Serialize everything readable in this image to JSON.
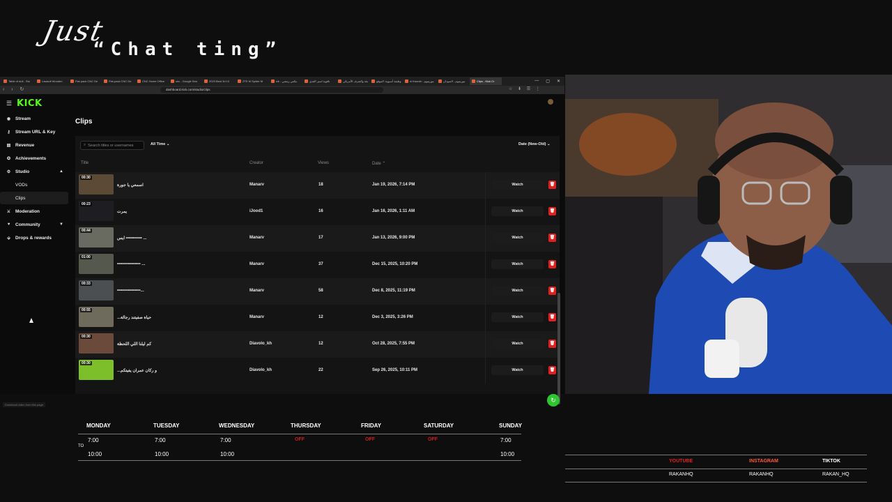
{
  "overlay": {
    "line1": "Just",
    "line2": "“Chat ting”"
  },
  "browser": {
    "tabs": [
      "Table of dull - Stu",
      "Lawsuit Wooden",
      "Flat pack CNC De",
      "Flat-pack CNC De",
      "CNC Home Office",
      "cnc - Google Sea",
      "2023 Best 3d 10",
      "ZTE M Spider M",
      "rdr - مكس ريتشي",
      "ناقوية اسيز القدي",
      "الأسابقة والشرف الأمريكي",
      "وظيفة أسيوية: الموقع",
      "ni fraurah - موريتيوم",
      "موريتيوم - السودان",
      "Clips - Kick Cr"
    ],
    "url": "dashboard.kick.com/studio/clips",
    "status_text": "Download video from this page"
  },
  "sidebar": {
    "logo": "KICK",
    "items": [
      {
        "label": "Stream",
        "icon": "stream-icon"
      },
      {
        "label": "Stream URL & Key",
        "icon": "key-icon"
      },
      {
        "label": "Revenue",
        "icon": "revenue-icon"
      },
      {
        "label": "Achievements",
        "icon": "achievements-icon"
      },
      {
        "label": "Studio",
        "icon": "studio-icon"
      },
      {
        "label": "VODs"
      },
      {
        "label": "Clips"
      },
      {
        "label": "Moderation",
        "icon": "moderation-icon"
      },
      {
        "label": "Community",
        "icon": "community-icon"
      },
      {
        "label": "Drops & rewards",
        "icon": "drops-icon"
      }
    ]
  },
  "main": {
    "heading": "Clips",
    "search_placeholder": "Search titles or usernames",
    "filter": "All Time",
    "sort": "Date (New-Old)",
    "columns": {
      "title": "Title",
      "creator": "Creator",
      "views": "Views",
      "date": "Date"
    },
    "watch_label": "Watch",
    "rows": [
      {
        "duration": "00:30",
        "title": "اسمعي يا جورة",
        "creator": "Manarv",
        "views": "18",
        "date": "Jan 19, 2026, 7:14 PM",
        "thumb": "#5a4a36"
      },
      {
        "duration": "00:23",
        "title": "يمرت",
        "creator": "iJood1",
        "views": "16",
        "date": "Jan 16, 2026, 1:11 AM",
        "thumb": "#1e1e22"
      },
      {
        "duration": "00:44",
        "title": "ايس ••••••••••• ...",
        "creator": "Manarv",
        "views": "17",
        "date": "Jan 13, 2026, 9:00 PM",
        "thumb": "#6a6b60"
      },
      {
        "duration": "01:00",
        "title": "•••••••••••••••• ...",
        "creator": "Manarv",
        "views": "37",
        "date": "Dec 15, 2025, 10:20 PM",
        "thumb": "#55584c"
      },
      {
        "duration": "00:33",
        "title": "••••••••••••••••...",
        "creator": "Manarv",
        "views": "58",
        "date": "Dec 8, 2025, 11:19 PM",
        "thumb": "#4c4f52"
      },
      {
        "duration": "00:55",
        "title": "...حياة صفيتند رجالة",
        "creator": "Manarv",
        "views": "12",
        "date": "Dec 3, 2025, 3:26 PM",
        "thumb": "#6e6a5c"
      },
      {
        "duration": "00:30",
        "title": "كم ليلنا اللي اللحظة",
        "creator": "Diavolo_kh",
        "views": "12",
        "date": "Oct 28, 2025, 7:55 PM",
        "thumb": "#6b4a3c"
      },
      {
        "duration": "00:30",
        "title": "...و ركان عمران يفيتكم",
        "creator": "Diavolo_kh",
        "views": "22",
        "date": "Sep 26, 2025, 10:11 PM",
        "thumb": "#7cbf2a"
      }
    ]
  },
  "schedule": {
    "days": [
      "MONDAY",
      "TUESDAY",
      "WEDNESDAY",
      "THURSDAY",
      "FRIDAY",
      "SATURDAY",
      "SUNDAY"
    ],
    "start": [
      "7:00",
      "7:00",
      "7:00",
      "OFF",
      "OFF",
      "OFF",
      "7:00"
    ],
    "end": [
      "10:00",
      "10:00",
      "10:00",
      "",
      "",
      "",
      "10:00"
    ],
    "to_label": "TO",
    "off_color": "#d01c1c"
  },
  "socials": [
    {
      "name": "YOUTUBE",
      "handle": "RAKANHQ",
      "color": "#e0201e"
    },
    {
      "name": "INSTAGRAM",
      "handle": "RAKANHQ",
      "color": "#ff5a3c"
    },
    {
      "name": "TIKTOK",
      "handle": "RAKAN_HQ",
      "color": "#ffffff"
    }
  ]
}
